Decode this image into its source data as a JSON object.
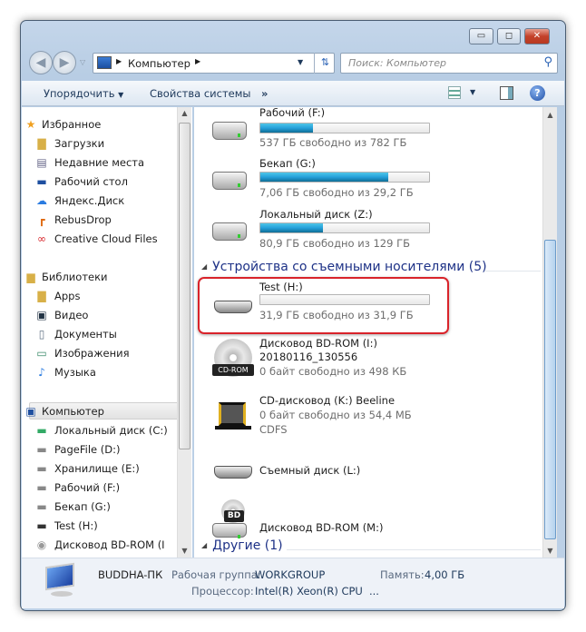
{
  "window": {
    "controls": {
      "minimize": "▭",
      "maximize": "◻",
      "close": "✕"
    }
  },
  "address": {
    "breadcrumb": "Компьютер",
    "search_placeholder": "Поиск: Компьютер"
  },
  "toolbar": {
    "organize": "Упорядочить",
    "system_properties": "Свойства системы",
    "more": "»"
  },
  "sidebar": {
    "favorites": {
      "label": "Избранное",
      "items": [
        {
          "label": "Загрузки",
          "icon": "downloads-folder-icon"
        },
        {
          "label": "Недавние места",
          "icon": "recent-places-icon"
        },
        {
          "label": "Рабочий стол",
          "icon": "desktop-icon"
        },
        {
          "label": "Яндекс.Диск",
          "icon": "yandex-disk-icon"
        },
        {
          "label": "RebusDrop",
          "icon": "rebusdrop-icon"
        },
        {
          "label": "Creative Cloud Files",
          "icon": "creative-cloud-icon"
        }
      ]
    },
    "libraries": {
      "label": "Библиотеки",
      "items": [
        {
          "label": "Apps"
        },
        {
          "label": "Видео"
        },
        {
          "label": "Документы"
        },
        {
          "label": "Изображения"
        },
        {
          "label": "Музыка"
        }
      ]
    },
    "computer": {
      "label": "Компьютер",
      "items": [
        {
          "label": "Локальный диск (C:)"
        },
        {
          "label": "PageFile (D:)"
        },
        {
          "label": "Хранилище (E:)"
        },
        {
          "label": "Рабочий (F:)"
        },
        {
          "label": "Бекап (G:)"
        },
        {
          "label": "Test (H:)"
        },
        {
          "label": "Дисковод BD-ROM (I"
        }
      ]
    }
  },
  "main": {
    "drives": [
      {
        "name": "Рабочий (F:)",
        "free": "537 ГБ свободно из 782 ГБ",
        "used_fraction": 0.31
      },
      {
        "name": "Бекап (G:)",
        "free": "7,06 ГБ свободно из 29,2 ГБ",
        "used_fraction": 0.76
      },
      {
        "name": "Локальный диск (Z:)",
        "free": "80,9 ГБ свободно из 129 ГБ",
        "used_fraction": 0.37
      }
    ],
    "removable_group": "Устройства со съемными носителями (5)",
    "removable": [
      {
        "name": "Test (H:)",
        "free": "31,9 ГБ свободно из 31,9 ГБ",
        "used_fraction": 0.0,
        "highlighted": true
      },
      {
        "name": "Дисковод BD-ROM (I:)",
        "label": "20180116_130556",
        "free": "0 байт свободно из 498 КБ",
        "icon_text": "CD-ROM"
      },
      {
        "name": "CD-дисковод (K:) Beeline",
        "free": "0 байт свободно из 54,4 МБ",
        "fs": "CDFS"
      },
      {
        "name": "Съемный диск (L:)"
      },
      {
        "name": "Дисковод BD-ROM (M:)",
        "icon_text": "BD"
      }
    ],
    "other_group": "Другие (1)"
  },
  "details": {
    "computer_name": "BUDDHA-ПК",
    "workgroup_label": "Рабочая группа:",
    "workgroup": "WORKGROUP",
    "memory_label": "Память:",
    "memory": "4,00 ГБ",
    "cpu_label": "Процессор:",
    "cpu": "Intel(R) Xeon(R) CPU",
    "cpu_more": "..."
  },
  "colors": {
    "highlight": "#d9232a",
    "bar_fill": "#26a0da"
  }
}
